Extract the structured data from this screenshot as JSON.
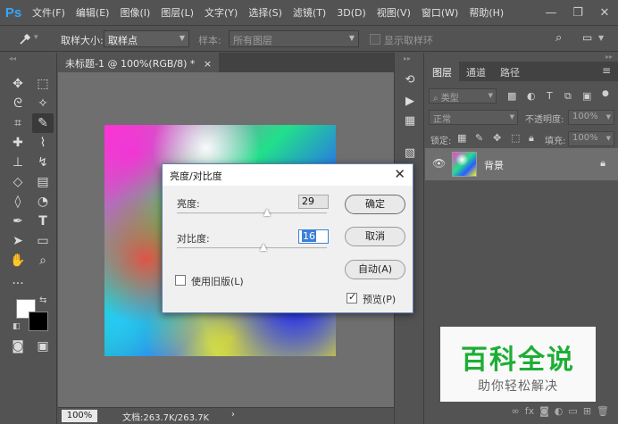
{
  "app": {
    "logo": "Ps",
    "accent": "#31a8ff"
  },
  "menu": [
    "文件(F)",
    "编辑(E)",
    "图像(I)",
    "图层(L)",
    "文字(Y)",
    "选择(S)",
    "滤镜(T)",
    "3D(D)",
    "视图(V)",
    "窗口(W)",
    "帮助(H)"
  ],
  "window_controls": {
    "minimize": "—",
    "restore": "❐",
    "close": "✕"
  },
  "options_bar": {
    "tool_icon": "eyedropper-icon",
    "sample_size_label": "取样大小:",
    "sample_size_value": "取样点",
    "sample_label": "样本:",
    "sample_value": "所有图层",
    "show_ring_label": "显示取样环"
  },
  "document": {
    "tab_title": "未标题-1 @ 100%(RGB/8) *",
    "tab_close": "×",
    "zoom": "100%",
    "info": "文档:263.7K/263.7K",
    "info_arrow": "›"
  },
  "layers_panel": {
    "tabs": [
      "图层",
      "通道",
      "路径"
    ],
    "active_tab": 0,
    "filter_kind": "类型",
    "blend_mode": "正常",
    "opacity_label": "不透明度:",
    "opacity_value": "100%",
    "lock_label": "锁定:",
    "fill_label": "填充:",
    "fill_value": "100%",
    "layer_name": "背景"
  },
  "dialog": {
    "title": "亮度/对比度",
    "brightness_label": "亮度:",
    "brightness_value": "29",
    "brightness_level": 0.6,
    "contrast_label": "对比度:",
    "contrast_value": "16",
    "contrast_level": 0.58,
    "legacy_label": "使用旧版(L)",
    "legacy_checked": false,
    "ok_label": "确定",
    "cancel_label": "取消",
    "auto_label": "自动(A)",
    "preview_label": "预览(P)",
    "preview_checked": true
  },
  "watermark": {
    "title": "百科全说",
    "subtitle": "助你轻松解决",
    "color": "#1dae35"
  }
}
